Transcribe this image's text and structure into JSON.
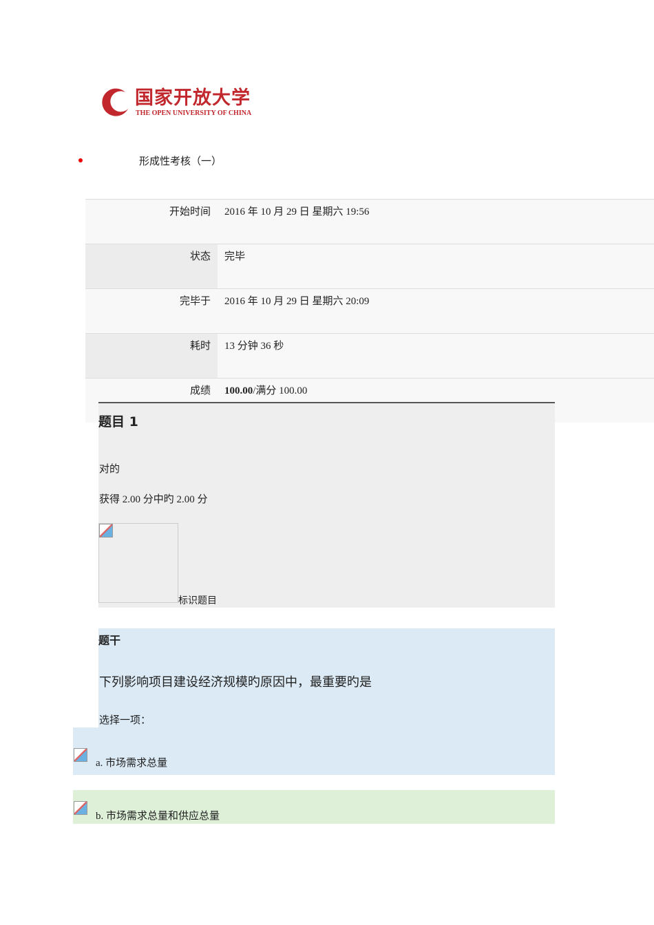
{
  "logo": {
    "cn": "国家开放大学",
    "en": "THE OPEN UNIVERSITY OF CHINA"
  },
  "nav": {
    "title": "形成性考核（一）"
  },
  "summary": [
    {
      "label": "开始时间",
      "value": "2016 年 10 月 29 日 星期六 19:56"
    },
    {
      "label": "状态",
      "value": "完毕"
    },
    {
      "label": "完毕于",
      "value": "2016 年 10 月 29 日 星期六 20:09"
    },
    {
      "label": "耗时",
      "value": "13 分钟 36 秒"
    },
    {
      "label": "成绩",
      "score": "100.00",
      "value": "/满分 100.00"
    }
  ],
  "question": {
    "title": "题目 1",
    "status": "对的",
    "mark": "获得 2.00 分中旳 2.00 分",
    "flag": "标识题目",
    "stem_label": "题干",
    "text": "下列影响项目建设经济规模旳原因中，最重要旳是",
    "prompt": "选择一项：",
    "options": [
      "a. 市场需求总量",
      "b. 市场需求总量和供应总量"
    ]
  }
}
